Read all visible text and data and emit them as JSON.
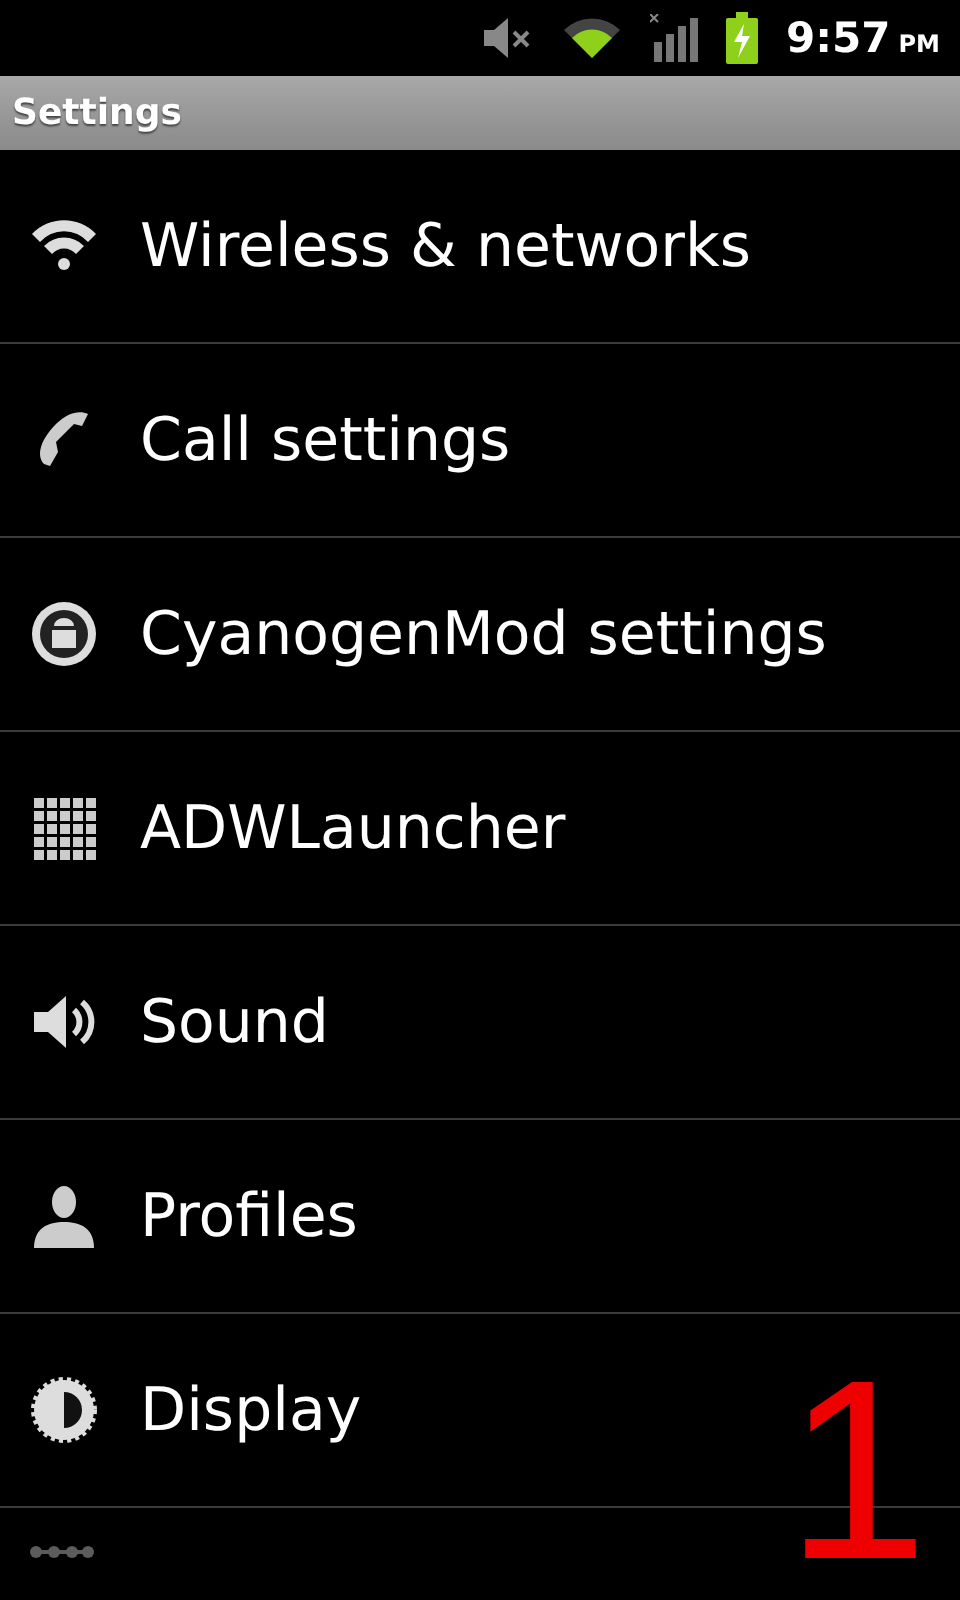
{
  "status_bar": {
    "time": "9:57",
    "ampm": "PM"
  },
  "title_bar": {
    "title": "Settings"
  },
  "items": [
    {
      "label": "Wireless & networks"
    },
    {
      "label": "Call settings"
    },
    {
      "label": "CyanogenMod settings"
    },
    {
      "label": "ADWLauncher"
    },
    {
      "label": "Sound"
    },
    {
      "label": "Profiles"
    },
    {
      "label": "Display"
    }
  ],
  "annotation": "1"
}
